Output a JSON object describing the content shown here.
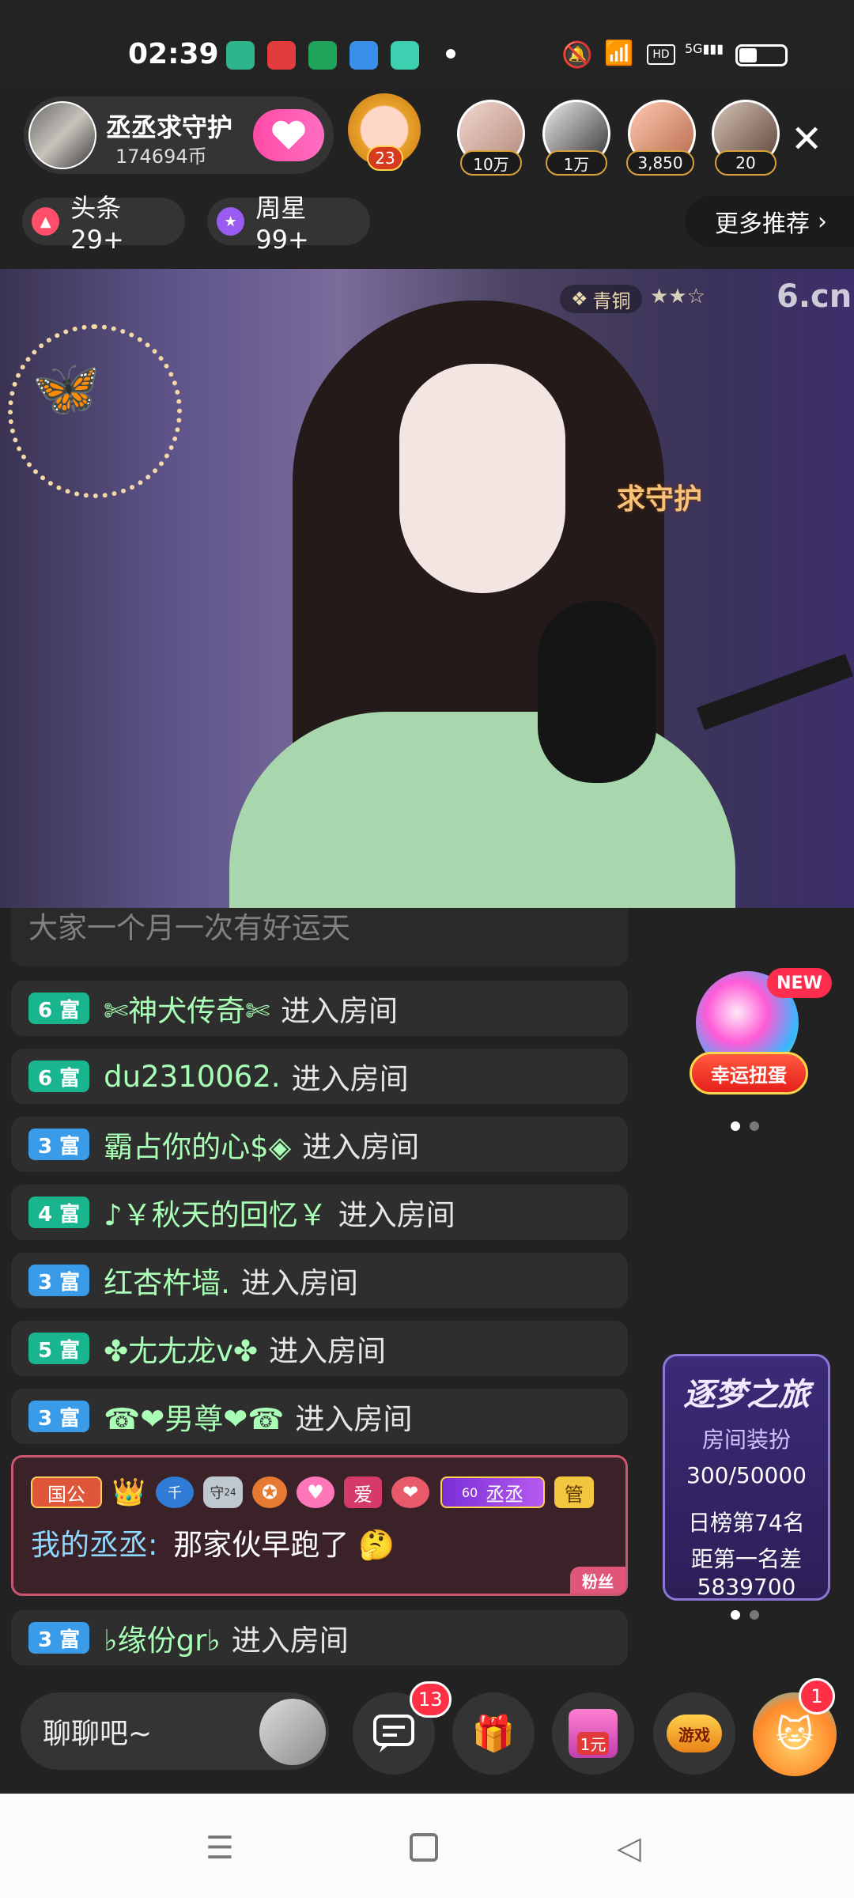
{
  "status_bar": {
    "time": "02:39"
  },
  "anchor": {
    "name": "丞丞求守护",
    "coins": "174694币"
  },
  "guard_badge": "23",
  "viewers": [
    {
      "count": "10万"
    },
    {
      "count": "1万"
    },
    {
      "count": "3,850"
    },
    {
      "count": "20"
    }
  ],
  "ranks": {
    "headline": "头条29+",
    "weekly_star": "周星99+",
    "more": "更多推荐"
  },
  "video": {
    "level_badge": "青铜",
    "stars": "★★☆",
    "logo": "6.cn",
    "overlay_text": "求守护"
  },
  "chat": {
    "partial_top": "大家一个月一次有好运天",
    "messages": [
      {
        "level": "6 富",
        "level_color": "#19b58f",
        "user": "✄神犬传奇✄",
        "action": "进入房间"
      },
      {
        "level": "6 富",
        "level_color": "#19b58f",
        "user": "du2310062.",
        "action": "进入房间"
      },
      {
        "level": "3 富",
        "level_color": "#3a9be8",
        "user": "霸占你的心$◈",
        "action": "进入房间"
      },
      {
        "level": "4 富",
        "level_color": "#19b58f",
        "user": "♪￥秋天的回忆￥",
        "action": "进入房间"
      },
      {
        "level": "3 富",
        "level_color": "#3a9be8",
        "user": "红杏杵墙.",
        "action": "进入房间"
      },
      {
        "level": "5 富",
        "level_color": "#19b58f",
        "user": "✤尢尢龙v✤",
        "action": "进入房间"
      },
      {
        "level": "3 富",
        "level_color": "#3a9be8",
        "user": "☎❤男尊❤☎",
        "action": "进入房间"
      }
    ],
    "special": {
      "tags": {
        "guo_gong": "国公",
        "shou": "守",
        "shou_lv": "24",
        "ai": "爱",
        "fan_name": "丞丞",
        "fan_level": "60",
        "guan": "管",
        "qian": "千"
      },
      "sender": "我的丞丞:",
      "text": "那家伙早跑了",
      "fans_label": "粉丝"
    },
    "last": {
      "level": "3 富",
      "level_color": "#3a9be8",
      "user": "♭缘份gr♭",
      "action": "进入房间"
    }
  },
  "widgets": {
    "lucky": {
      "label": "幸运扭蛋",
      "new": "NEW"
    },
    "dream": {
      "title": "逐梦之旅",
      "subtitle": "房间装扮",
      "progress": "300/50000",
      "rank": "日榜第74名",
      "gap_label": "距第一名差",
      "gap_value": "5839700"
    }
  },
  "bottom": {
    "chat_placeholder": "聊聊吧~",
    "msg_badge": "13",
    "yuan_label": "1元",
    "game_label": "游戏",
    "game_badge": "1"
  },
  "colors": {
    "accent_pink": "#ff4aa6",
    "green_name": "#a9ffb5"
  }
}
